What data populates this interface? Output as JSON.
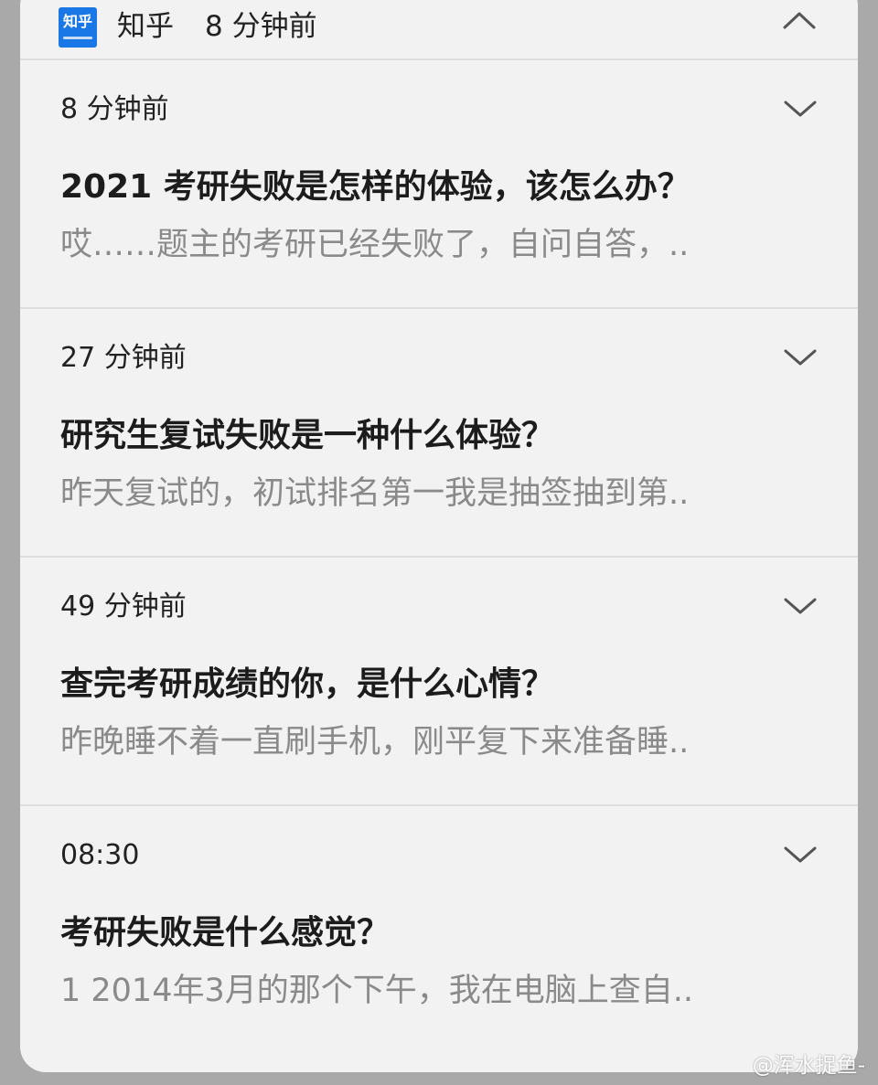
{
  "header": {
    "app_icon_text": "知乎",
    "app_name": "知乎",
    "time": "8 分钟前"
  },
  "items": [
    {
      "time": "8 分钟前",
      "title": "2021 考研失败是怎样的体验，该怎么办？",
      "preview": "哎……题主的考研已经失败了，自问自答，.."
    },
    {
      "time": "27 分钟前",
      "title": "研究生复试失败是一种什么体验？",
      "preview": "昨天复试的，初试排名第一我是抽签抽到第.."
    },
    {
      "time": "49 分钟前",
      "title": "查完考研成绩的你，是什么心情？",
      "preview": "昨晚睡不着一直刷手机，刚平复下来准备睡.."
    },
    {
      "time": "08:30",
      "title": "考研失败是什么感觉？",
      "preview": "1 2014年3月的那个下午，我在电脑上查自.."
    }
  ],
  "watermark": "@浑水捉鱼-",
  "colors": {
    "background": "#a9a9a9",
    "card": "#f2f2f2",
    "divider": "#dcdcdc",
    "title": "#1c1c1c",
    "preview": "#8a8a8a",
    "app_icon": "#1a78e6"
  },
  "icons": {
    "header_action": "chevron-up-icon",
    "item_action": "chevron-down-icon",
    "watermark_logo": "weibo-logo-icon"
  }
}
